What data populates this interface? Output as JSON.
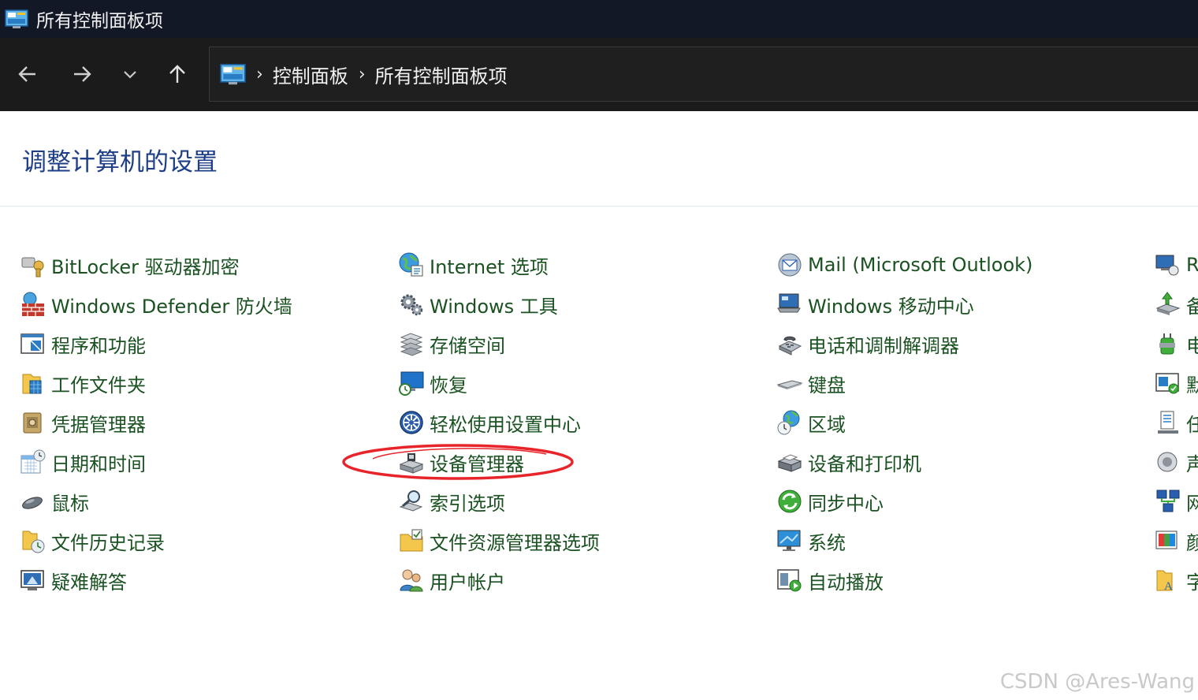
{
  "window": {
    "title": "所有控制面板项"
  },
  "nav": {
    "back_icon": "arrow-left-icon",
    "forward_icon": "arrow-right-icon",
    "recent_icon": "chevron-down-icon",
    "up_icon": "arrow-up-icon"
  },
  "address": {
    "crumbs": [
      {
        "label": "控制面板"
      },
      {
        "label": "所有控制面板项"
      }
    ],
    "separator": "›"
  },
  "heading": "调整计算机的设置",
  "columns": [
    [
      {
        "label": "BitLocker 驱动器加密",
        "icon": "bitlocker-key-icon"
      },
      {
        "label": "Windows Defender 防火墙",
        "icon": "firewall-icon"
      },
      {
        "label": "程序和功能",
        "icon": "programs-icon"
      },
      {
        "label": "工作文件夹",
        "icon": "work-folders-icon"
      },
      {
        "label": "凭据管理器",
        "icon": "credential-vault-icon"
      },
      {
        "label": "日期和时间",
        "icon": "calendar-clock-icon"
      },
      {
        "label": "鼠标",
        "icon": "mouse-icon"
      },
      {
        "label": "文件历史记录",
        "icon": "file-history-icon"
      },
      {
        "label": "疑难解答",
        "icon": "troubleshoot-icon"
      }
    ],
    [
      {
        "label": "Internet 选项",
        "icon": "globe-icon"
      },
      {
        "label": "Windows 工具",
        "icon": "gears-icon"
      },
      {
        "label": "存储空间",
        "icon": "storage-stack-icon"
      },
      {
        "label": "恢复",
        "icon": "recovery-monitor-icon"
      },
      {
        "label": "轻松使用设置中心",
        "icon": "ease-of-access-icon"
      },
      {
        "label": "设备管理器",
        "icon": "device-manager-icon"
      },
      {
        "label": "索引选项",
        "icon": "indexing-magnifier-icon"
      },
      {
        "label": "文件资源管理器选项",
        "icon": "folder-check-icon"
      },
      {
        "label": "用户帐户",
        "icon": "users-icon"
      }
    ],
    [
      {
        "label": "Mail (Microsoft Outlook)",
        "icon": "mail-icon"
      },
      {
        "label": "Windows 移动中心",
        "icon": "mobility-center-icon"
      },
      {
        "label": "电话和调制解调器",
        "icon": "phone-modem-icon"
      },
      {
        "label": "键盘",
        "icon": "keyboard-icon"
      },
      {
        "label": "区域",
        "icon": "region-globe-icon"
      },
      {
        "label": "设备和打印机",
        "icon": "printer-icon"
      },
      {
        "label": "同步中心",
        "icon": "sync-icon"
      },
      {
        "label": "系统",
        "icon": "system-monitor-icon"
      },
      {
        "label": "自动播放",
        "icon": "autoplay-icon"
      }
    ],
    [
      {
        "label": "R",
        "icon": "remote-app-icon"
      },
      {
        "label": "备",
        "icon": "backup-icon"
      },
      {
        "label": "电",
        "icon": "power-icon"
      },
      {
        "label": "默",
        "icon": "default-programs-icon"
      },
      {
        "label": "任",
        "icon": "taskbar-icon"
      },
      {
        "label": "声",
        "icon": "speaker-icon"
      },
      {
        "label": "网",
        "icon": "network-icon"
      },
      {
        "label": "颜",
        "icon": "color-icon"
      },
      {
        "label": "字",
        "icon": "font-icon"
      }
    ]
  ],
  "annotation": {
    "icon": "red-ellipse-icon",
    "color": "#e8242b"
  },
  "watermark": "CSDN @Ares-Wang",
  "colors": {
    "link": "#1a5221",
    "heading": "#1e3e87",
    "titlebar": "#121826",
    "navbar": "#1b1b1b"
  }
}
